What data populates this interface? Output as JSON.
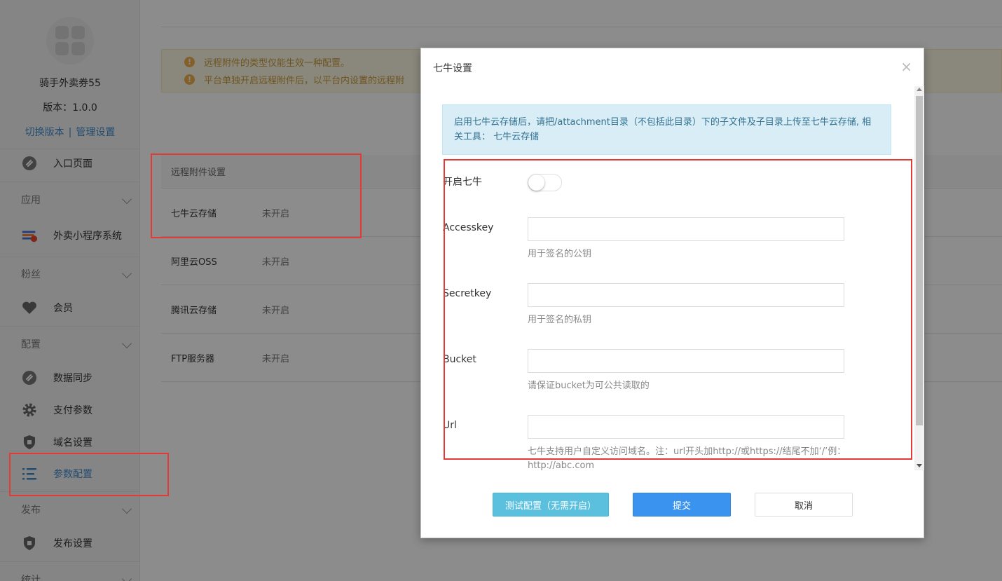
{
  "app": {
    "name": "骑手外卖券55",
    "version": "版本：1.0.0",
    "switch_version": "切换版本",
    "separator": "|",
    "manage_settings": "管理设置"
  },
  "sidebar": {
    "entry": "入口页面",
    "groups": {
      "apps": "应用",
      "fans": "粉丝",
      "config": "配置",
      "publish": "发布",
      "stats": "统计"
    },
    "items": {
      "takeout": "外卖小程序系统",
      "member": "会员",
      "data_sync": "数据同步",
      "payment": "支付参数",
      "domain": "域名设置",
      "params": "参数配置",
      "publish_settings": "发布设置"
    }
  },
  "alert": {
    "line1": "远程附件的类型仅能生效一种配置。",
    "line2": "平台单独开启远程附件后，以平台内设置的远程附"
  },
  "remote_table": {
    "header": "远程附件设置",
    "rows": [
      {
        "name": "七牛云存储",
        "status": "未开启"
      },
      {
        "name": "阿里云OSS",
        "status": "未开启"
      },
      {
        "name": "腾讯云存储",
        "status": "未开启"
      },
      {
        "name": "FTP服务器",
        "status": "未开启"
      }
    ]
  },
  "modal": {
    "title": "七牛设置",
    "close": "×",
    "info_text": "启用七牛云存储后，请把/attachment目录（不包括此目录）下的子文件及子目录上传至七牛云存储, 相关工具：",
    "info_link": "七牛云存储",
    "enable_label": "开启七牛",
    "enable_value": false,
    "fields": {
      "accesskey": {
        "label": "Accesskey",
        "value": "",
        "help": "用于签名的公钥"
      },
      "secretkey": {
        "label": "Secretkey",
        "value": "",
        "help": "用于签名的私钥"
      },
      "bucket": {
        "label": "Bucket",
        "value": "",
        "help": "请保证bucket为可公共读取的"
      },
      "url": {
        "label": "Url",
        "value": "",
        "help": "七牛支持用户自定义访问域名。注：url开头加http://或https://结尾不加‘/’例：http://abc.com"
      }
    },
    "buttons": {
      "test": "测试配置（无需开启）",
      "submit": "提交",
      "cancel": "取消"
    }
  },
  "colors": {
    "accent": "#428bca",
    "primary_button": "#3b93f0",
    "info_button": "#5bc0de",
    "highlight_box": "#e53935",
    "warning": "#f0ad4e"
  }
}
